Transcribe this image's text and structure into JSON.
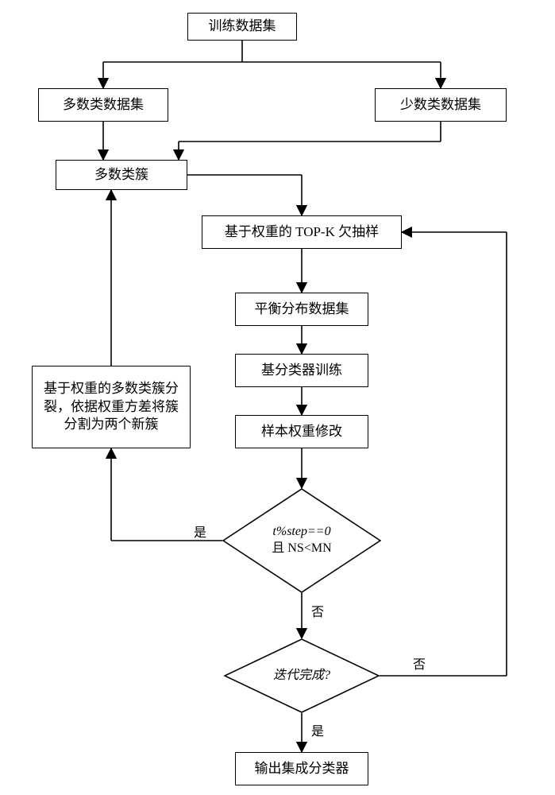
{
  "nodes": {
    "train": "训练数据集",
    "majority": "多数类数据集",
    "minority": "少数类数据集",
    "cluster": "多数类簇",
    "topk": "基于权重的 TOP-K 欠抽样",
    "balanced": "平衡分布数据集",
    "basetrain": "基分类器训练",
    "reweight": "样本权重修改",
    "split": "基于权重的多数类簇分裂，依据权重方差将簇分割为两个新簇",
    "cond1_l1": "t%step==0",
    "cond1_l2": "且  NS<MN",
    "cond2": "迭代完成?",
    "output": "输出集成分类器"
  },
  "labels": {
    "yes": "是",
    "no": "否"
  }
}
